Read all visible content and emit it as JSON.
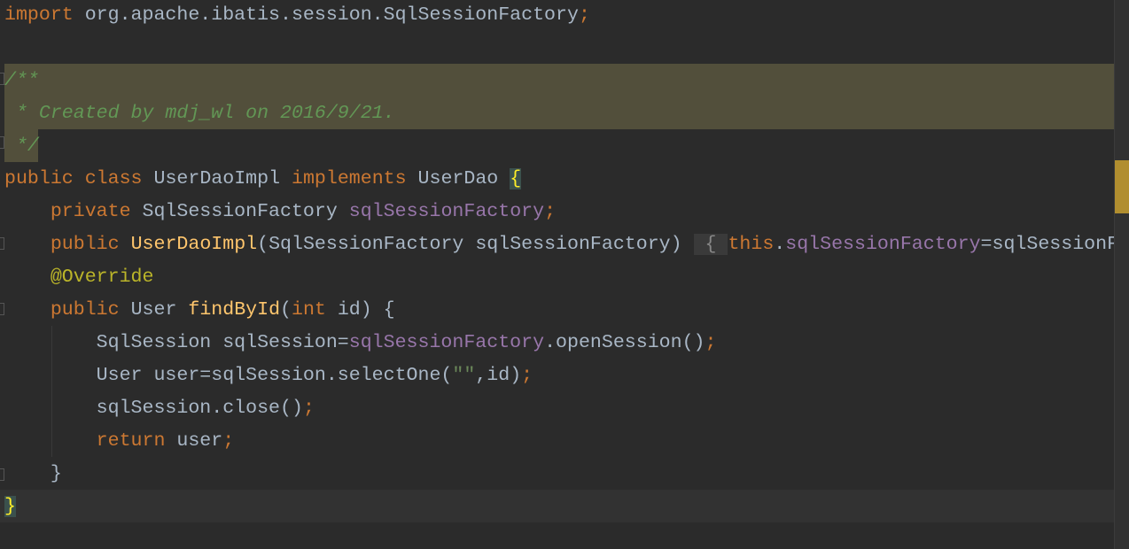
{
  "editor": {
    "colors": {
      "background": "#2b2b2b",
      "keyword": "#cc7832",
      "comment": "#629755",
      "field": "#9876aa",
      "method": "#ffc66d",
      "annotation": "#bbb529",
      "text": "#a9b7c6",
      "comment_highlight": "#524f3b",
      "current_line": "#323232",
      "brace_match": "#3b514d"
    },
    "lines": [
      [
        [
          "import ",
          "kw"
        ],
        [
          "org.apache.ibatis.session.SqlSessionFactory",
          "txt"
        ],
        [
          ";",
          "kw"
        ]
      ],
      [],
      [
        [
          "/**",
          "cm"
        ]
      ],
      [
        [
          " * Created by mdj_wl on 2016/9/21.",
          "cm"
        ]
      ],
      [
        [
          " */",
          "cm"
        ]
      ],
      [
        [
          "public ",
          "kw"
        ],
        [
          "class ",
          "kw"
        ],
        [
          "UserDaoImpl ",
          "txt"
        ],
        [
          "implements ",
          "kw"
        ],
        [
          "UserDao ",
          "txt"
        ],
        [
          "{",
          "brace-match"
        ]
      ],
      [
        [
          "    "
        ],
        [
          "private ",
          "kw"
        ],
        [
          "SqlSessionFactory ",
          "txt"
        ],
        [
          "sqlSessionFactory",
          "fld"
        ],
        [
          ";",
          "kw"
        ]
      ],
      [
        [
          "    "
        ],
        [
          "public ",
          "kw"
        ],
        [
          "UserDaoImpl",
          "mth"
        ],
        [
          "(SqlSessionFactory sqlSessionFactory)",
          "txt"
        ],
        [
          " "
        ],
        [
          " { ",
          "brace-fold"
        ],
        [
          "this",
          "kw"
        ],
        [
          ".",
          "txt"
        ],
        [
          "sqlSessionFactory",
          "fld"
        ],
        [
          "=sqlSessionFac",
          "txt"
        ]
      ],
      [
        [
          "    "
        ],
        [
          "@Override",
          "ann"
        ]
      ],
      [
        [
          "    "
        ],
        [
          "public ",
          "kw"
        ],
        [
          "User ",
          "txt"
        ],
        [
          "findById",
          "mth"
        ],
        [
          "(",
          "txt"
        ],
        [
          "int ",
          "kw"
        ],
        [
          "id) {",
          "txt"
        ]
      ],
      [
        [
          "        "
        ],
        [
          "SqlSession sqlSession=",
          "txt"
        ],
        [
          "sqlSessionFactory",
          "fld"
        ],
        [
          ".openSession()",
          "txt"
        ],
        [
          ";",
          "kw"
        ]
      ],
      [
        [
          "        "
        ],
        [
          "User user=sqlSession.selectOne(",
          "txt"
        ],
        [
          "\"\"",
          "str"
        ],
        [
          ",id)",
          "txt"
        ],
        [
          ";",
          "kw"
        ]
      ],
      [
        [
          "        "
        ],
        [
          "sqlSession.close()",
          "txt"
        ],
        [
          ";",
          "kw"
        ]
      ],
      [
        [
          "        "
        ],
        [
          "return ",
          "kw"
        ],
        [
          "user",
          "txt"
        ],
        [
          ";",
          "kw"
        ]
      ],
      [
        [
          "    "
        ],
        [
          "}",
          "txt"
        ]
      ],
      [
        [
          "}",
          "brace-match"
        ]
      ]
    ]
  }
}
